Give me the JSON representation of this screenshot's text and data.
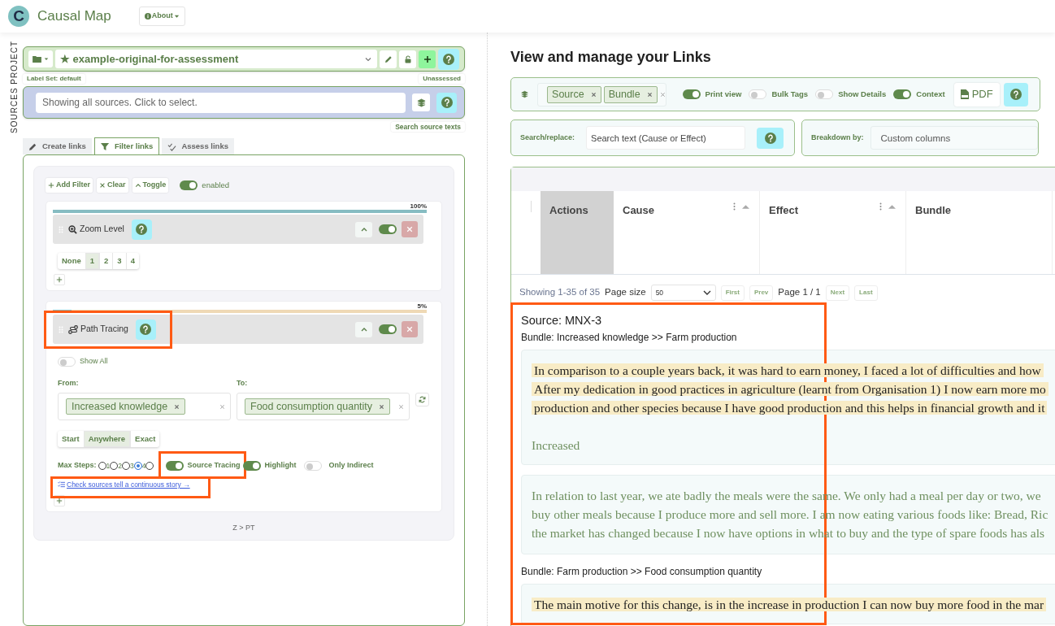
{
  "header": {
    "logo_letter": "C",
    "app_name": "Causal Map",
    "about_button": "About"
  },
  "side_label": "SOURCES PROJECT",
  "project": {
    "name": "★ example-original-for-assessment",
    "label_set": "Label Set: default",
    "assessment": "Unassessed"
  },
  "sources": {
    "placeholder": "Showing all sources. Click to select.",
    "search_link": "Search source texts"
  },
  "tabs": [
    {
      "label": "Create links",
      "selected": false
    },
    {
      "label": "Filter links",
      "selected": true
    },
    {
      "label": "Assess links",
      "selected": false
    }
  ],
  "filter_toolbar": {
    "buttons": [
      "Add Filter",
      "Clear",
      "Toggle"
    ],
    "enabled": {
      "label": "enabled",
      "on": true
    }
  },
  "filters": [
    {
      "kind": "zoom",
      "title": "Zoom Level",
      "level": 1.0,
      "progress_label": "100%",
      "on": true,
      "options": [
        {
          "label": "None",
          "selected": false
        },
        {
          "label": "1",
          "selected": true
        },
        {
          "label": "2",
          "selected": false
        },
        {
          "label": "3",
          "selected": false
        },
        {
          "label": "4",
          "selected": false
        }
      ]
    },
    {
      "kind": "path",
      "title": "Path Tracing",
      "level": 0.05,
      "progress_label": "5%",
      "on": true,
      "show_all": {
        "label": "Show All",
        "on": false
      },
      "from": {
        "label": "From:",
        "tags": [
          "Increased knowledge"
        ]
      },
      "to": {
        "label": "To:",
        "tags": [
          "Food consumption quantity"
        ]
      },
      "match_modes": [
        {
          "label": "Start",
          "selected": false
        },
        {
          "label": "Anywhere",
          "selected": true
        },
        {
          "label": "Exact",
          "selected": false
        }
      ],
      "max_steps": {
        "label": "Max Steps:",
        "options": [
          {
            "label": "1",
            "selected": false
          },
          {
            "label": "2",
            "selected": false
          },
          {
            "label": "3",
            "selected": false
          },
          {
            "label": "4",
            "selected": true
          },
          {
            "selected": false
          }
        ]
      },
      "toggles": [
        {
          "label": "Source Tracing",
          "on": true
        },
        {
          "label": "Highlight",
          "on": true
        },
        {
          "label": "Only Indirect",
          "on": false
        }
      ],
      "link": "Check sources tell a continuous story →"
    }
  ],
  "breadcrumb": "Z > PT",
  "links_view": {
    "title": "View and manage your Links",
    "group_tags": [
      "Source",
      "Bundle"
    ],
    "toggles": [
      {
        "label": "Print view",
        "on": true
      },
      {
        "label": "Bulk Tags",
        "on": false
      },
      {
        "label": "Show Details",
        "on": false
      },
      {
        "label": "Context",
        "on": true
      }
    ],
    "pdf_button": "PDF",
    "search": {
      "label": "Search/replace:",
      "placeholder": "Search text (Cause or Effect)"
    },
    "breakdown": {
      "label": "Breakdown by:",
      "placeholder": "Custom columns"
    }
  },
  "table": {
    "columns": [
      {
        "label": "Actions",
        "sortable": false
      },
      {
        "label": "Cause",
        "sortable": true
      },
      {
        "label": "Effect",
        "sortable": true
      },
      {
        "label": "Bundle",
        "sortable": false
      }
    ]
  },
  "pagination": {
    "summary": "Showing 1-35 of 35",
    "page_size_label": "Page size",
    "page_size": "50",
    "before": [
      "First",
      "Prev"
    ],
    "page": "Page 1 / 1",
    "after": [
      "Next",
      "Last"
    ]
  },
  "report": {
    "source": "Source: MNX-3",
    "bundles": [
      {
        "title": "Bundle: Increased knowledge >> Farm production",
        "quotes": [
          {
            "highlighted": true,
            "lines": [
              "In comparison to a couple years back, it was hard to earn money, I faced a lot of difficulties and how",
              "After my dedication in good practices in agriculture (learnt from Organisation 1) I now earn more mo",
              "production and other species because I have good production and this helps in financial growth and it"
            ],
            "note": "Increased"
          },
          {
            "highlighted": false,
            "lines": [
              "In relation to last year, we ate badly the meals were the same. We only had a meal per day or two, we",
              "buy other meals because I produce more and sell more. I am now eating various foods like: Bread, Ric",
              "the market has changed because I now have options in what to buy and the type of spare foods has als"
            ]
          }
        ]
      },
      {
        "title": "Bundle: Farm production >> Food consumption quantity",
        "quotes": [
          {
            "highlighted": true,
            "lines": [
              "The main motive for this change, is in the increase in production I can now buy more food in the mar"
            ]
          }
        ]
      }
    ]
  }
}
